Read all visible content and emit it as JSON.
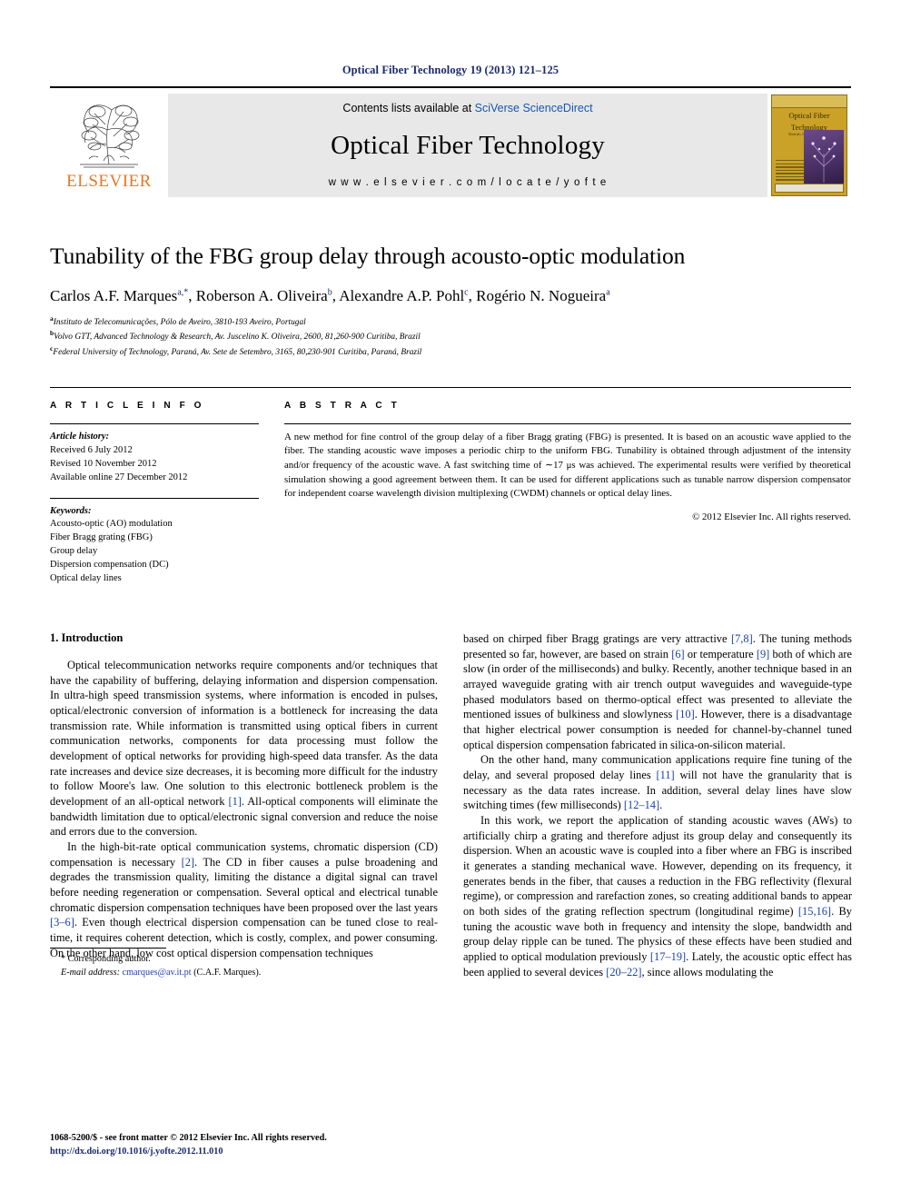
{
  "running_head": "Optical Fiber Technology 19 (2013) 121–125",
  "masthead": {
    "publisher": "ELSEVIER",
    "contents_prefix": "Contents lists available at ",
    "contents_link": "SciVerse ScienceDirect",
    "journal_name": "Optical Fiber Technology",
    "journal_url": "w w w . e l s e v i e r . c o m / l o c a t e / y o f t e",
    "cover_title_line1": "Optical Fiber",
    "cover_title_line2": "Technology",
    "cover_subtitle": "Materials, Devices and Systems"
  },
  "article": {
    "title": "Tunability of the FBG group delay through acousto-optic modulation",
    "authors": "Carlos A.F. Marques , Roberson A. Oliveira , Alexandre A.P. Pohl , Rogério N. Nogueira",
    "author_list": [
      {
        "name": "Carlos A.F. Marques",
        "marks": "a,*"
      },
      {
        "name": "Roberson A. Oliveira",
        "marks": "b"
      },
      {
        "name": "Alexandre A.P. Pohl",
        "marks": "c"
      },
      {
        "name": "Rogério N. Nogueira",
        "marks": "a"
      }
    ],
    "affiliations": [
      {
        "mark": "a",
        "text": "Instituto de Telecomunicações, Pólo de Aveiro, 3810-193 Aveiro, Portugal"
      },
      {
        "mark": "b",
        "text": "Volvo GTT, Advanced Technology & Research, Av. Juscelino K. Oliveira, 2600, 81,260-900 Curitiba, Brazil"
      },
      {
        "mark": "c",
        "text": "Federal University of Technology, Paraná, Av. Sete de Setembro, 3165, 80,230-901 Curitiba, Paraná, Brazil"
      }
    ]
  },
  "article_info": {
    "heading": "A R T I C L E  I N F O",
    "history_label": "Article history:",
    "history": [
      "Received 6 July 2012",
      "Revised 10 November 2012",
      "Available online 27 December 2012"
    ],
    "keywords_label": "Keywords:",
    "keywords": [
      "Acousto-optic (AO) modulation",
      "Fiber Bragg grating (FBG)",
      "Group delay",
      "Dispersion compensation (DC)",
      "Optical delay lines"
    ]
  },
  "abstract": {
    "heading": "A B S T R A C T",
    "text": "A new method for fine control of the group delay of a fiber Bragg grating (FBG) is presented. It is based on an acoustic wave applied to the fiber. The standing acoustic wave imposes a periodic chirp to the uniform FBG. Tunability is obtained through adjustment of the intensity and/or frequency of the acoustic wave. A fast switching time of ∼17 μs was achieved. The experimental results were verified by theoretical simulation showing a good agreement between them. It can be used for different applications such as tunable narrow dispersion compensator for independent coarse wavelength division multiplexing (CWDM) channels or optical delay lines.",
    "copyright": "© 2012 Elsevier Inc. All rights reserved."
  },
  "body": {
    "section1_title": "1. Introduction",
    "left_paragraphs": [
      "Optical telecommunication networks require components and/or techniques that have the capability of buffering, delaying information and dispersion compensation. In ultra-high speed transmission systems, where information is encoded in pulses, optical/electronic conversion of information is a bottleneck for increasing the data transmission rate. While information is transmitted using optical fibers in current communication networks, components for data processing must follow the development of optical networks for providing high-speed data transfer. As the data rate increases and device size decreases, it is becoming more difficult for the industry to follow Moore's law. One solution to this electronic bottleneck problem is the development of an all-optical network [1]. All-optical components will eliminate the bandwidth limitation due to optical/electronic signal conversion and reduce the noise and errors due to the conversion.",
      "In the high-bit-rate optical communication systems, chromatic dispersion (CD) compensation is necessary [2]. The CD in fiber causes a pulse broadening and degrades the transmission quality, limiting the distance a digital signal can travel before needing regeneration or compensation. Several optical and electrical tunable chromatic dispersion compensation techniques have been proposed over the last years [3–6]. Even though electrical dispersion compensation can be tuned close to real-time, it requires coherent detection, which is costly, complex, and power consuming. On the other hand, low cost optical dispersion compensation techniques"
    ],
    "right_paragraphs": [
      "based on chirped fiber Bragg gratings are very attractive [7,8]. The tuning methods presented so far, however, are based on strain [6] or temperature [9] both of which are slow (in order of the milliseconds) and bulky. Recently, another technique based in an arrayed waveguide grating with air trench output waveguides and waveguide-type phased modulators based on thermo-optical effect was presented to alleviate the mentioned issues of bulkiness and slowlyness [10]. However, there is a disadvantage that higher electrical power consumption is needed for channel-by-channel tuned optical dispersion compensation fabricated in silica-on-silicon material.",
      "On the other hand, many communication applications require fine tuning of the delay, and several proposed delay lines [11] will not have the granularity that is necessary as the data rates increase. In addition, several delay lines have slow switching times (few milliseconds) [12–14].",
      "In this work, we report the application of standing acoustic waves (AWs) to artificially chirp a grating and therefore adjust its group delay and consequently its dispersion. When an acoustic wave is coupled into a fiber where an FBG is inscribed it generates a standing mechanical wave. However, depending on its frequency, it generates bends in the fiber, that causes a reduction in the FBG reflectivity (flexural regime), or compression and rarefaction zones, so creating additional bands to appear on both sides of the grating reflection spectrum (longitudinal regime) [15,16]. By tuning the acoustic wave both in frequency and intensity the slope, bandwidth and group delay ripple can be tuned. The physics of these effects have been studied and applied to optical modulation previously [17–19]. Lately, the acoustic optic effect has been applied to several devices [20–22], since allows modulating the"
    ]
  },
  "footnote": {
    "corresponding": "* Corresponding author.",
    "email_label": "E-mail address:",
    "email": "cmarques@av.it.pt",
    "email_suffix": " (C.A.F. Marques)."
  },
  "footer": {
    "issn_line": "1068-5200/$ - see front matter © 2012 Elsevier Inc. All rights reserved.",
    "doi": "http://dx.doi.org/10.1016/j.yofte.2012.11.010"
  },
  "colors": {
    "link_blue": "#1557b0",
    "ref_blue": "#1a3faa",
    "header_navy": "#1a2a6c",
    "elsevier_orange": "#E87722"
  }
}
